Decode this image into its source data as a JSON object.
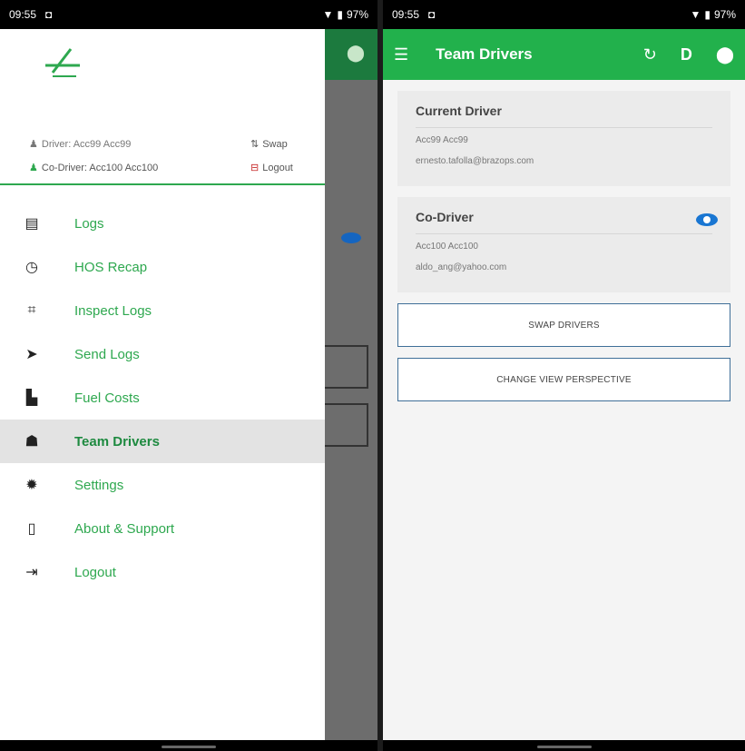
{
  "left": {
    "status": {
      "time": "09:55",
      "battery": "97%"
    },
    "drawer": {
      "driver_label": "Driver: Acc99 Acc99",
      "codriver_label": "Co-Driver: Acc100 Acc100",
      "swap_label": "Swap",
      "logout_label": "Logout",
      "menu": [
        {
          "label": "Logs",
          "icon": "logs-icon"
        },
        {
          "label": "HOS Recap",
          "icon": "alarm-icon"
        },
        {
          "label": "Inspect Logs",
          "icon": "inspect-icon"
        },
        {
          "label": "Send Logs",
          "icon": "send-icon"
        },
        {
          "label": "Fuel Costs",
          "icon": "fuel-icon"
        },
        {
          "label": "Team Drivers",
          "icon": "team-icon",
          "active": true
        },
        {
          "label": "Settings",
          "icon": "gear-icon"
        },
        {
          "label": "About & Support",
          "icon": "phone-icon"
        },
        {
          "label": "Logout",
          "icon": "logout-icon"
        }
      ]
    }
  },
  "right": {
    "status": {
      "time": "09:55",
      "battery": "97%"
    },
    "appbar": {
      "title": "Team Drivers"
    },
    "current_driver": {
      "title": "Current Driver",
      "name": "Acc99 Acc99",
      "email": "ernesto.tafolla@brazops.com"
    },
    "co_driver": {
      "title": "Co-Driver",
      "name": "Acc100 Acc100",
      "email": "aldo_ang@yahoo.com"
    },
    "buttons": {
      "swap": "SWAP DRIVERS",
      "perspective": "CHANGE VIEW PERSPECTIVE"
    }
  },
  "colors": {
    "brand_green": "#22b14c",
    "accent_blue": "#1976d2"
  }
}
